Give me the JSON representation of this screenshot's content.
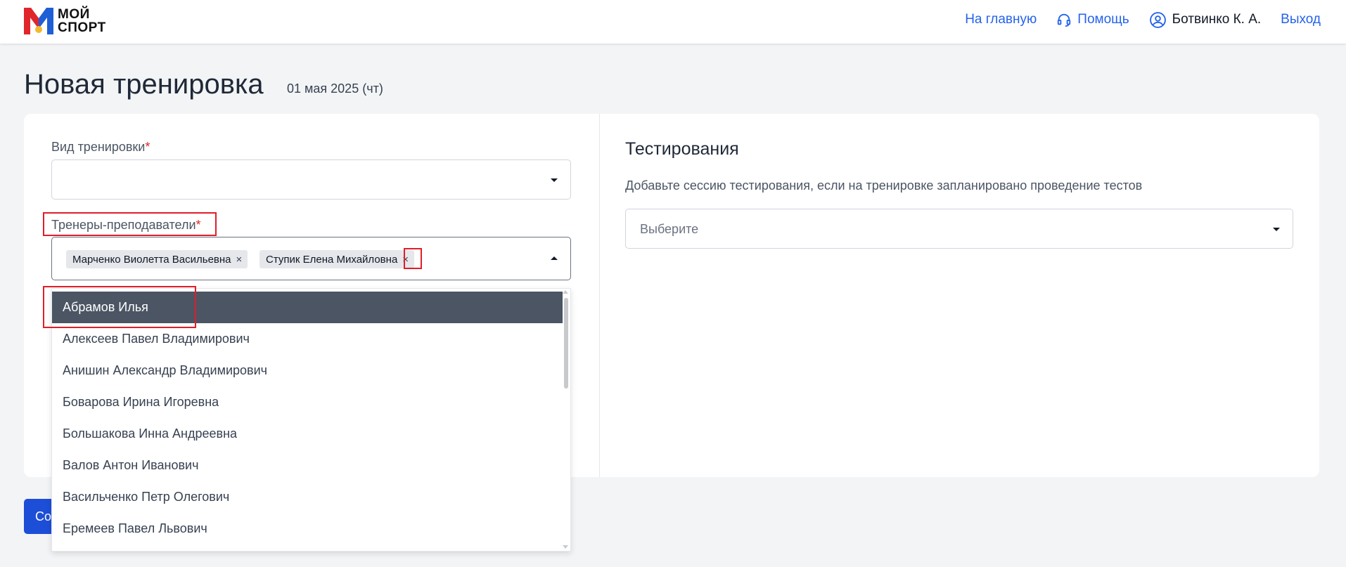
{
  "header": {
    "logo_text_line1": "МОЙ",
    "logo_text_line2": "СПОРТ",
    "nav_home": "На главную",
    "nav_help": "Помощь",
    "user_name": "Ботвинко К. А.",
    "nav_logout": "Выход"
  },
  "page": {
    "title": "Новая тренировка",
    "date": "01 мая 2025 (чт)"
  },
  "form": {
    "training_type_label": "Вид тренировки",
    "required_mark": "*",
    "coaches_label": "Тренеры-преподаватели",
    "selected_coaches": [
      "Марченко Виолетта Васильевна",
      "Ступик Елена Михайловна"
    ],
    "chip_remove": "×",
    "options": [
      "Абрамов Илья",
      "Алексеев Павел Владимирович",
      "Анишин Александр Владимирович",
      "Боварова Ирина Игоревна",
      "Большакова Инна Андреевна",
      "Валов Антон Иванович",
      "Васильченко Петр Олегович",
      "Еремеев Павел Львович"
    ],
    "save_button_visible": "Со"
  },
  "testing": {
    "title": "Тестирования",
    "description": "Добавьте сессию тестирования, если на тренировке запланировано проведение тестов",
    "placeholder": "Выберите"
  },
  "colors": {
    "accent": "#2563eb",
    "highlight": "#e11d2a",
    "option_active_bg": "#4b5563",
    "logo_red": "#e0262b",
    "logo_blue": "#1f5fd6",
    "logo_yellow": "#f5b82e"
  }
}
